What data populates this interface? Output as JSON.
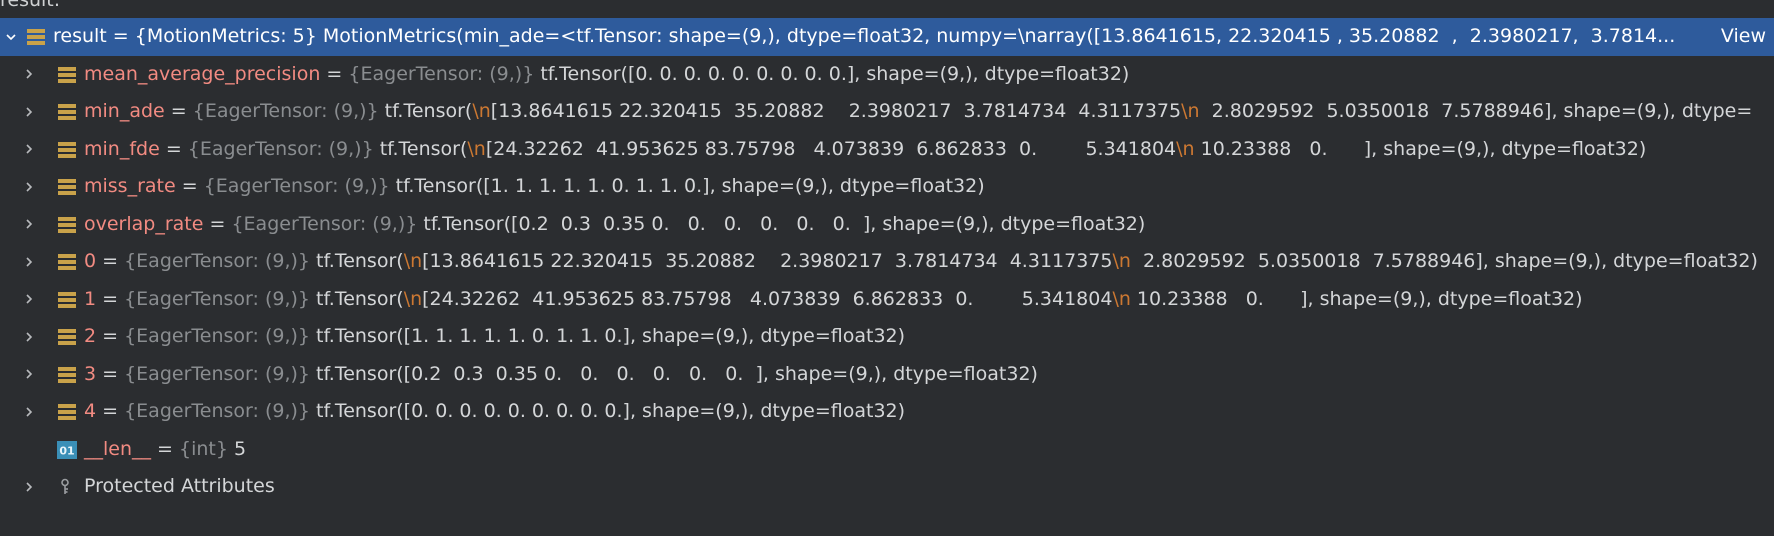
{
  "panel": {
    "header_text": "result:"
  },
  "rows": [
    {
      "kind": "selected",
      "expanded": true,
      "name": "result",
      "eq": " = ",
      "type": "{MotionMetrics: 5}",
      "value": " MotionMetrics(min_ade=<tf.Tensor: shape=(9,), dtype=float32, numpy=\\narray([13.8641615, 22.320415 , 35.20882  ,  2.3980217,  3.7814",
      "ellipsis": "...",
      "view": "View",
      "icon": "list-icon"
    },
    {
      "name": "mean_average_precision",
      "eq": " = ",
      "type": "{EagerTensor: (9,)}",
      "parts": [
        " tf.Tensor([0. 0. 0. 0. 0. 0. 0. 0. 0.], shape=(9,), dtype=float32)"
      ],
      "icon": "list-icon"
    },
    {
      "name": "min_ade",
      "eq": " = ",
      "type": "{EagerTensor: (9,)}",
      "parts": [
        " tf.Tensor(",
        "\\n",
        "[13.8641615 22.320415  35.20882    2.3980217  3.7814734  4.3117375",
        "\\n",
        "  2.8029592  5.0350018  7.5788946], shape=(9,), dtype="
      ],
      "icon": "list-icon"
    },
    {
      "name": "min_fde",
      "eq": " = ",
      "type": "{EagerTensor: (9,)}",
      "parts": [
        " tf.Tensor(",
        "\\n",
        "[24.32262  41.953625 83.75798   4.073839  6.862833  0.        5.341804",
        "\\n",
        " 10.23388   0.      ], shape=(9,), dtype=float32)"
      ],
      "icon": "list-icon"
    },
    {
      "name": "miss_rate",
      "eq": " = ",
      "type": "{EagerTensor: (9,)}",
      "parts": [
        " tf.Tensor([1. 1. 1. 1. 1. 0. 1. 1. 0.], shape=(9,), dtype=float32)"
      ],
      "icon": "list-icon"
    },
    {
      "name": "overlap_rate",
      "eq": " = ",
      "type": "{EagerTensor: (9,)}",
      "parts": [
        " tf.Tensor([0.2  0.3  0.35 0.   0.   0.   0.   0.   0.  ], shape=(9,), dtype=float32)"
      ],
      "icon": "list-icon"
    },
    {
      "name": "0",
      "eq": " = ",
      "type": "{EagerTensor: (9,)}",
      "parts": [
        " tf.Tensor(",
        "\\n",
        "[13.8641615 22.320415  35.20882    2.3980217  3.7814734  4.3117375",
        "\\n",
        "  2.8029592  5.0350018  7.5788946], shape=(9,), dtype=float32)"
      ],
      "icon": "list-icon"
    },
    {
      "name": "1",
      "eq": " = ",
      "type": "{EagerTensor: (9,)}",
      "parts": [
        " tf.Tensor(",
        "\\n",
        "[24.32262  41.953625 83.75798   4.073839  6.862833  0.        5.341804",
        "\\n",
        " 10.23388   0.      ], shape=(9,), dtype=float32)"
      ],
      "icon": "list-icon"
    },
    {
      "name": "2",
      "eq": " = ",
      "type": "{EagerTensor: (9,)}",
      "parts": [
        " tf.Tensor([1. 1. 1. 1. 1. 0. 1. 1. 0.], shape=(9,), dtype=float32)"
      ],
      "icon": "list-icon"
    },
    {
      "name": "3",
      "eq": " = ",
      "type": "{EagerTensor: (9,)}",
      "parts": [
        " tf.Tensor([0.2  0.3  0.35 0.   0.   0.   0.   0.   0.  ], shape=(9,), dtype=float32)"
      ],
      "icon": "list-icon"
    },
    {
      "name": "4",
      "eq": " = ",
      "type": "{EagerTensor: (9,)}",
      "parts": [
        " tf.Tensor([0. 0. 0. 0. 0. 0. 0. 0. 0.], shape=(9,), dtype=float32)"
      ],
      "icon": "list-icon"
    },
    {
      "name": "__len__",
      "eq": " = ",
      "type": "{int}",
      "parts": [
        " 5"
      ],
      "icon": "int-icon",
      "no_arrow": true,
      "icon_label": "01"
    },
    {
      "name": "Protected Attributes",
      "plain": true,
      "icon": "key-icon"
    }
  ],
  "colors": {
    "background": "#2b2d30",
    "selection": "#2e5b9c",
    "name": "#f28b82",
    "type": "#8a8d90",
    "escape": "#cc7832",
    "icon_list": "#c9a24a",
    "icon_int": "#3a8fb7"
  }
}
